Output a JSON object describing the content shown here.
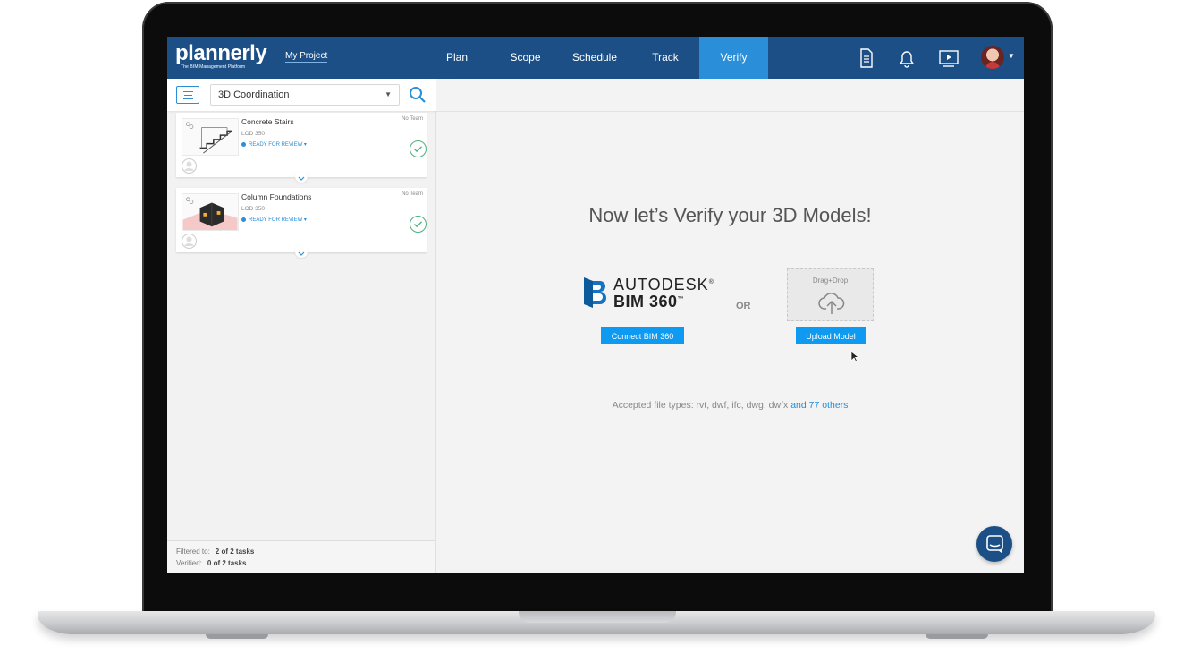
{
  "brand": {
    "name": "plannerly",
    "tagline": "The BIM Management Platform"
  },
  "header": {
    "project": "My Project",
    "tabs": [
      {
        "label": "Plan"
      },
      {
        "label": "Scope"
      },
      {
        "label": "Schedule"
      },
      {
        "label": "Track"
      },
      {
        "label": "Verify",
        "active": true
      }
    ],
    "icons": [
      "document-icon",
      "bell-icon",
      "video-icon",
      "avatar"
    ]
  },
  "filter": {
    "selected": "3D Coordination"
  },
  "tasks": [
    {
      "title": "Concrete Stairs",
      "lod": "LOD 350",
      "status": "READY FOR REVIEW ▾",
      "team": "No Team"
    },
    {
      "title": "Column Foundations",
      "lod": "LOD 350",
      "status": "READY FOR REVIEW ▾",
      "team": "No Team"
    }
  ],
  "footer": {
    "filtered_label": "Filtered to:",
    "filtered_value": "2 of 2 tasks",
    "verified_label": "Verified:",
    "verified_value": "0 of 2 tasks"
  },
  "main": {
    "headline": "Now let’s Verify your 3D Models!",
    "bim": {
      "line1": "AUTODESK",
      "line1_mark": "®",
      "line2": "BIM 360",
      "line2_mark": "™",
      "button": "Connect BIM 360"
    },
    "or_label": "OR",
    "upload": {
      "drop_label": "Drag+Drop",
      "button": "Upload Model"
    },
    "accepted_text": "Accepted file types: rvt, dwf, ifc, dwg, dwfx",
    "accepted_link": "and 77 others"
  },
  "colors": {
    "nav": "#1b4f86",
    "nav_active": "#2a8fd8",
    "button": "#0d9af0",
    "check": "#4caf7d"
  }
}
